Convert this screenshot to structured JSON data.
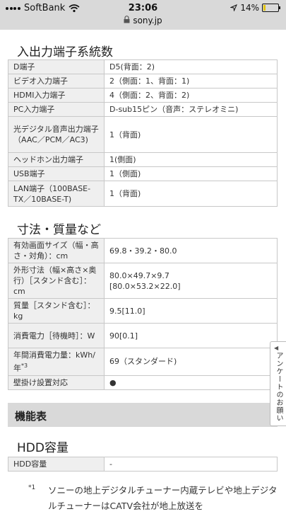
{
  "status_bar": {
    "carrier": "SoftBank",
    "time": "23:06",
    "battery": "14%",
    "battery_level": 0.14,
    "url": "sony.jp"
  },
  "io_section": {
    "heading": "入出力端子系統数",
    "rows": [
      {
        "label": "D端子",
        "value": "D5(背面：2)"
      },
      {
        "label": "ビデオ入力端子",
        "value": "2（側面：1、背面：1)"
      },
      {
        "label": "HDMI入力端子",
        "value": "4（側面：2、背面：2)"
      },
      {
        "label": "PC入力端子",
        "value": "D-sub15ピン（音声：ステレオミニ)"
      },
      {
        "label": "光デジタル音声出力端子（AAC／PCM／AC3)",
        "value": "1（背面)"
      },
      {
        "label": "ヘッドホン出力端子",
        "value": "1(側面)"
      },
      {
        "label": "USB端子",
        "value": "1（側面)"
      },
      {
        "label": "LAN端子（100BASE-TX／10BASE-T)",
        "value": "1（背面)"
      }
    ]
  },
  "size_section": {
    "heading": "寸法・質量など",
    "rows": [
      {
        "label": "有効画面サイズ（幅・高さ・対角）：cm",
        "value": "69.8・39.2・80.0"
      },
      {
        "label": "外形寸法（幅×高さ×奥行）［スタンド含む］：cm",
        "value": "80.0×49.7×9.7",
        "value2": "[80.0×53.2×22.0]"
      },
      {
        "label": "質量［スタンド含む］：kg",
        "value": "9.5[11.0]"
      },
      {
        "label": "消費電力［待機時］：W",
        "value": "90[0.1]"
      },
      {
        "label": "年間消費電力量：kWh/年",
        "label_sup": "*3",
        "value": "69（スタンダード)"
      },
      {
        "label": "壁掛け設置対応",
        "value": "●"
      }
    ]
  },
  "features_bar": {
    "title": "機能表"
  },
  "hdd_section": {
    "heading": "HDD容量",
    "rows": [
      {
        "label": "HDD容量",
        "value": "-"
      }
    ]
  },
  "survey_tab": {
    "label": "アンケートのお願い"
  },
  "footnote": {
    "marker": "*1",
    "text": "ソニーの地上デジタルチューナー内蔵テレビや地上デジタルチューナーはCATV会社が地上放送を"
  }
}
